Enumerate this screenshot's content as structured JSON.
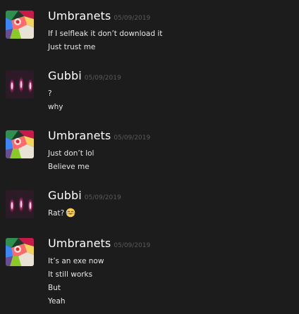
{
  "messages": [
    {
      "author": "Umbranets",
      "timestamp": "05/09/2019",
      "avatar": "umbranets-avatar",
      "lines": [
        "If I selfleak it don’t download it",
        "Just trust me"
      ]
    },
    {
      "author": "Gubbi",
      "timestamp": "05/09/2019",
      "avatar": "gubbi-avatar",
      "lines": [
        "?",
        "why"
      ]
    },
    {
      "author": "Umbranets",
      "timestamp": "05/09/2019",
      "avatar": "umbranets-avatar",
      "lines": [
        "Just don’t lol",
        "Believe me"
      ]
    },
    {
      "author": "Gubbi",
      "timestamp": "05/09/2019",
      "avatar": "gubbi-avatar",
      "lines": [
        "Rat?"
      ],
      "emoji": "joy-emoji"
    },
    {
      "author": "Umbranets",
      "timestamp": "05/09/2019",
      "avatar": "umbranets-avatar",
      "lines": [
        "It’s an exe now",
        "It still works",
        "But",
        "Yeah"
      ]
    }
  ]
}
